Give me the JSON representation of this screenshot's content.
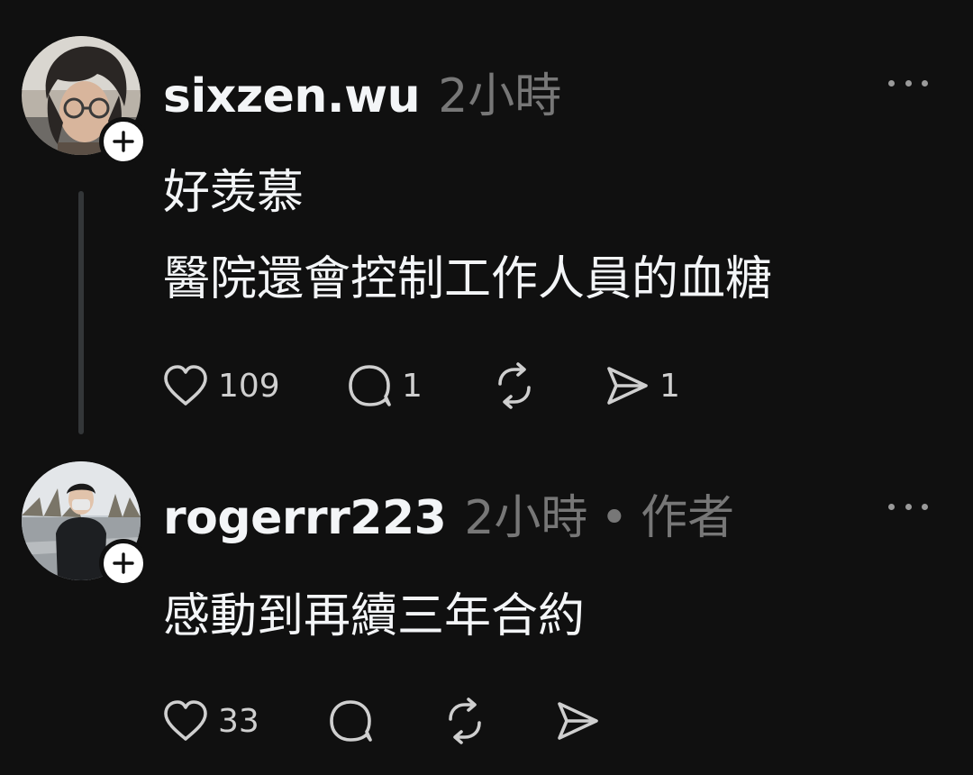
{
  "thread": {
    "posts": [
      {
        "username": "sixzen.wu",
        "time": "2小時",
        "author_label": "",
        "lines": [
          "好羡慕",
          "醫院還會控制工作人員的血糖"
        ],
        "likes": "109",
        "replies": "1",
        "reposts": "",
        "shares": "1"
      },
      {
        "username": "rogerrr223",
        "time": "2小時",
        "separator": "•",
        "author_label": "作者",
        "lines": [
          "感動到再續三年合約"
        ],
        "likes": "33",
        "replies": "",
        "reposts": "",
        "shares": ""
      }
    ]
  },
  "icons": {
    "like": "heart-icon",
    "reply": "comment-icon",
    "repost": "repost-icon",
    "share": "send-icon",
    "more": "more-icon",
    "follow": "plus-icon"
  },
  "colors": {
    "background": "#101010",
    "text_primary": "#f3f5f7",
    "text_secondary": "#777777",
    "icon": "#cfcfcf",
    "thread_line": "#333638"
  }
}
